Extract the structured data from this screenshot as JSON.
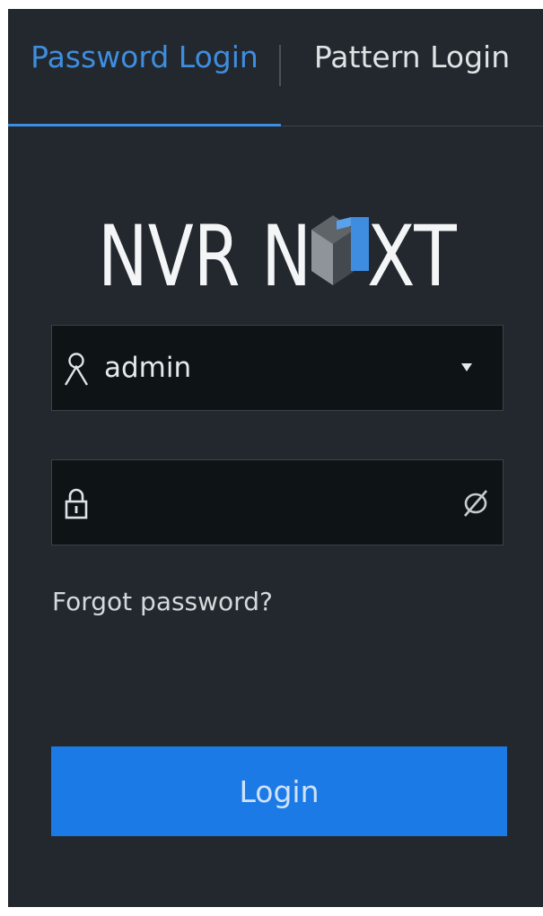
{
  "tabs": {
    "password_login": "Password Login",
    "pattern_login": "Pattern Login",
    "active": "password_login"
  },
  "logo": {
    "text": "NVR NEXT",
    "part1": "NVR N",
    "part2": "XT"
  },
  "username": {
    "value": "admin"
  },
  "password": {
    "value": ""
  },
  "links": {
    "forgot_password": "Forgot password?"
  },
  "buttons": {
    "login": "Login"
  },
  "icons": {
    "user": "user-icon",
    "lock": "lock-icon",
    "dropdown": "caret-down-icon",
    "visibility": "eye-off-icon"
  },
  "colors": {
    "accent": "#1c7ae6",
    "active_tab": "#3f8de0",
    "panel_bg": "#22282d",
    "field_bg": "#0e1316"
  }
}
